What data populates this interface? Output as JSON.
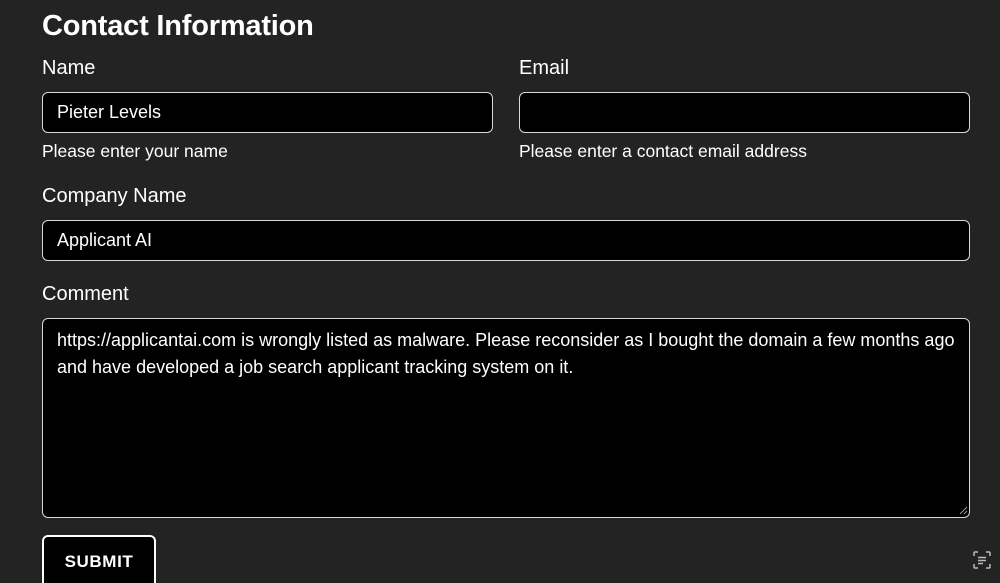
{
  "form": {
    "title": "Contact Information",
    "name": {
      "label": "Name",
      "value": "Pieter Levels",
      "help": "Please enter your name"
    },
    "email": {
      "label": "Email",
      "value": "",
      "help": "Please enter a contact email address"
    },
    "company": {
      "label": "Company Name",
      "value": "Applicant AI"
    },
    "comment": {
      "label": "Comment",
      "value": "https://applicantai.com is wrongly listed as malware. Please reconsider as I bought the domain a few months ago and have developed a job search applicant tracking system on it."
    },
    "submit_label": "SUBMIT"
  },
  "icons": {
    "resize": "resize-grip-icon",
    "scan": "scan-text-icon"
  }
}
